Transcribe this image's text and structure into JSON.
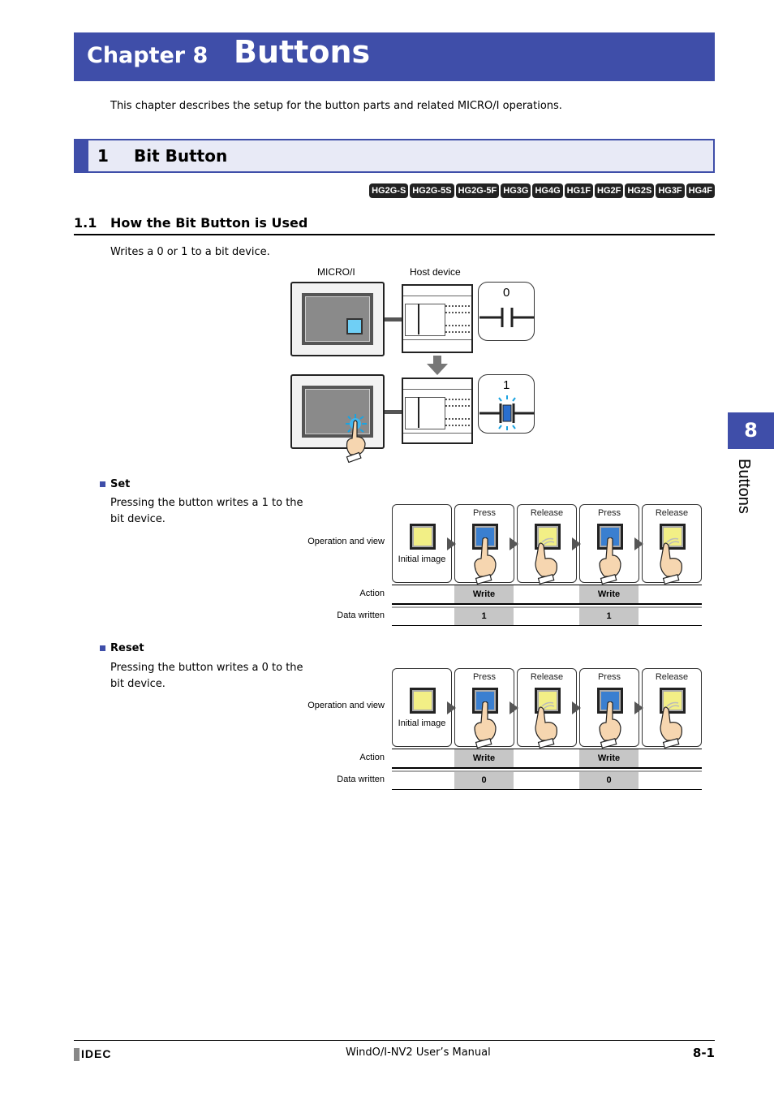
{
  "header": {
    "chapter_label": "Chapter 8",
    "chapter_title": "Buttons",
    "intro": "This chapter describes the setup for the button parts and related MICRO/I operations."
  },
  "section": {
    "number": "1",
    "title": "Bit Button",
    "models": [
      "HG2G-S",
      "HG2G-5S",
      "HG2G-5F",
      "HG3G",
      "HG4G",
      "HG1F",
      "HG2F",
      "HG2S",
      "HG3F",
      "HG4F"
    ]
  },
  "subsection": {
    "number": "1.1",
    "title": "How the Bit Button is Used",
    "description": "Writes a 0 or 1 to a bit device."
  },
  "diagram": {
    "micro_label": "MICRO/I",
    "host_label": "Host device",
    "state_before": "0",
    "state_after": "1"
  },
  "set": {
    "heading": "Set",
    "text": "Pressing the button writes a 1 to the bit device.",
    "row_label_operation": "Operation and view",
    "row_label_action": "Action",
    "row_label_data": "Data written",
    "steps": [
      {
        "title": "",
        "caption": "Initial image",
        "state": "yellow",
        "hand": "none"
      },
      {
        "title": "Press",
        "caption": "",
        "state": "blue",
        "hand": "press"
      },
      {
        "title": "Release",
        "caption": "",
        "state": "yellow",
        "hand": "release"
      },
      {
        "title": "Press",
        "caption": "",
        "state": "blue",
        "hand": "press"
      },
      {
        "title": "Release",
        "caption": "",
        "state": "yellow",
        "hand": "release"
      }
    ],
    "actions": [
      "",
      "Write",
      "",
      "Write",
      ""
    ],
    "data": [
      "",
      "1",
      "",
      "1",
      ""
    ]
  },
  "reset": {
    "heading": "Reset",
    "text": "Pressing the button writes a 0 to the bit device.",
    "row_label_operation": "Operation and view",
    "row_label_action": "Action",
    "row_label_data": "Data written",
    "steps": [
      {
        "title": "",
        "caption": "Initial image",
        "state": "yellow",
        "hand": "none"
      },
      {
        "title": "Press",
        "caption": "",
        "state": "blue",
        "hand": "press"
      },
      {
        "title": "Release",
        "caption": "",
        "state": "yellow",
        "hand": "release"
      },
      {
        "title": "Press",
        "caption": "",
        "state": "blue",
        "hand": "press"
      },
      {
        "title": "Release",
        "caption": "",
        "state": "yellow",
        "hand": "release"
      }
    ],
    "actions": [
      "",
      "Write",
      "",
      "Write",
      ""
    ],
    "data": [
      "",
      "0",
      "",
      "0",
      ""
    ]
  },
  "side_tab": {
    "number": "8",
    "label": "Buttons"
  },
  "footer": {
    "logo": "IDEC",
    "manual_title": "WindO/I-NV2 User’s Manual",
    "page": "8-1"
  },
  "colors": {
    "brand_blue": "#3f4ea9",
    "section_bg": "#e8eaf6",
    "button_yellow": "#f2ef86",
    "button_blue": "#3a7fd0",
    "cell_grey": "#c6c6c6"
  }
}
